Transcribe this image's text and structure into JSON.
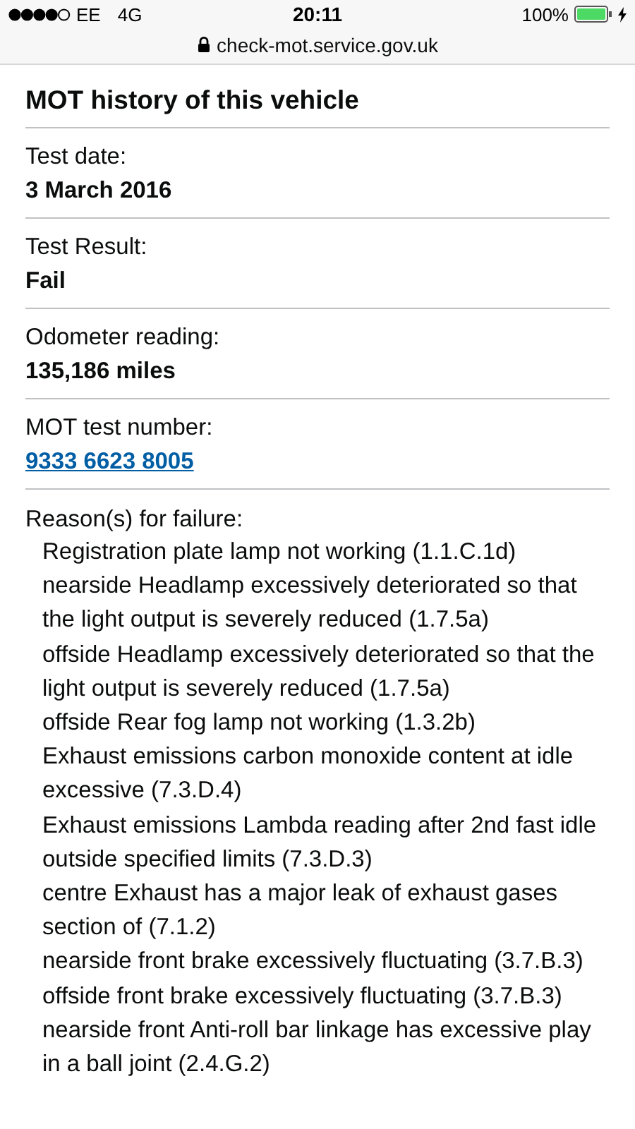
{
  "status_bar": {
    "carrier": "EE",
    "network": "4G",
    "time": "20:11",
    "battery": "100%"
  },
  "address_bar": {
    "url": "check-mot.service.gov.uk"
  },
  "heading": "MOT history of this vehicle",
  "fields": [
    {
      "label": "Test date:",
      "value": "3 March 2016",
      "kind": "text"
    },
    {
      "label": "Test Result:",
      "value": "Fail",
      "kind": "text"
    },
    {
      "label": "Odometer reading:",
      "value": "135,186 miles",
      "kind": "text"
    },
    {
      "label": "MOT test number:",
      "value": "9333 6623 8005",
      "kind": "link"
    }
  ],
  "reasons": {
    "label": "Reason(s) for failure:",
    "items": [
      "Registration plate lamp not working (1.1.C.1d)",
      "nearside Headlamp excessively deteriorated so that the light output is severely reduced (1.7.5a)",
      "offside Headlamp excessively deteriorated so that the light output is severely reduced (1.7.5a)",
      "offside Rear fog lamp not working (1.3.2b)",
      "Exhaust emissions carbon monoxide content at idle excessive (7.3.D.4)",
      "Exhaust emissions Lambda reading after 2nd fast idle outside specified limits (7.3.D.3)",
      "centre Exhaust has a major leak of exhaust gases section of (7.1.2)",
      "nearside front brake excessively fluctuating (3.7.B.3)",
      "offside front brake excessively fluctuating (3.7.B.3)",
      "nearside front Anti-roll bar linkage has excessive play in a ball joint (2.4.G.2)"
    ]
  }
}
